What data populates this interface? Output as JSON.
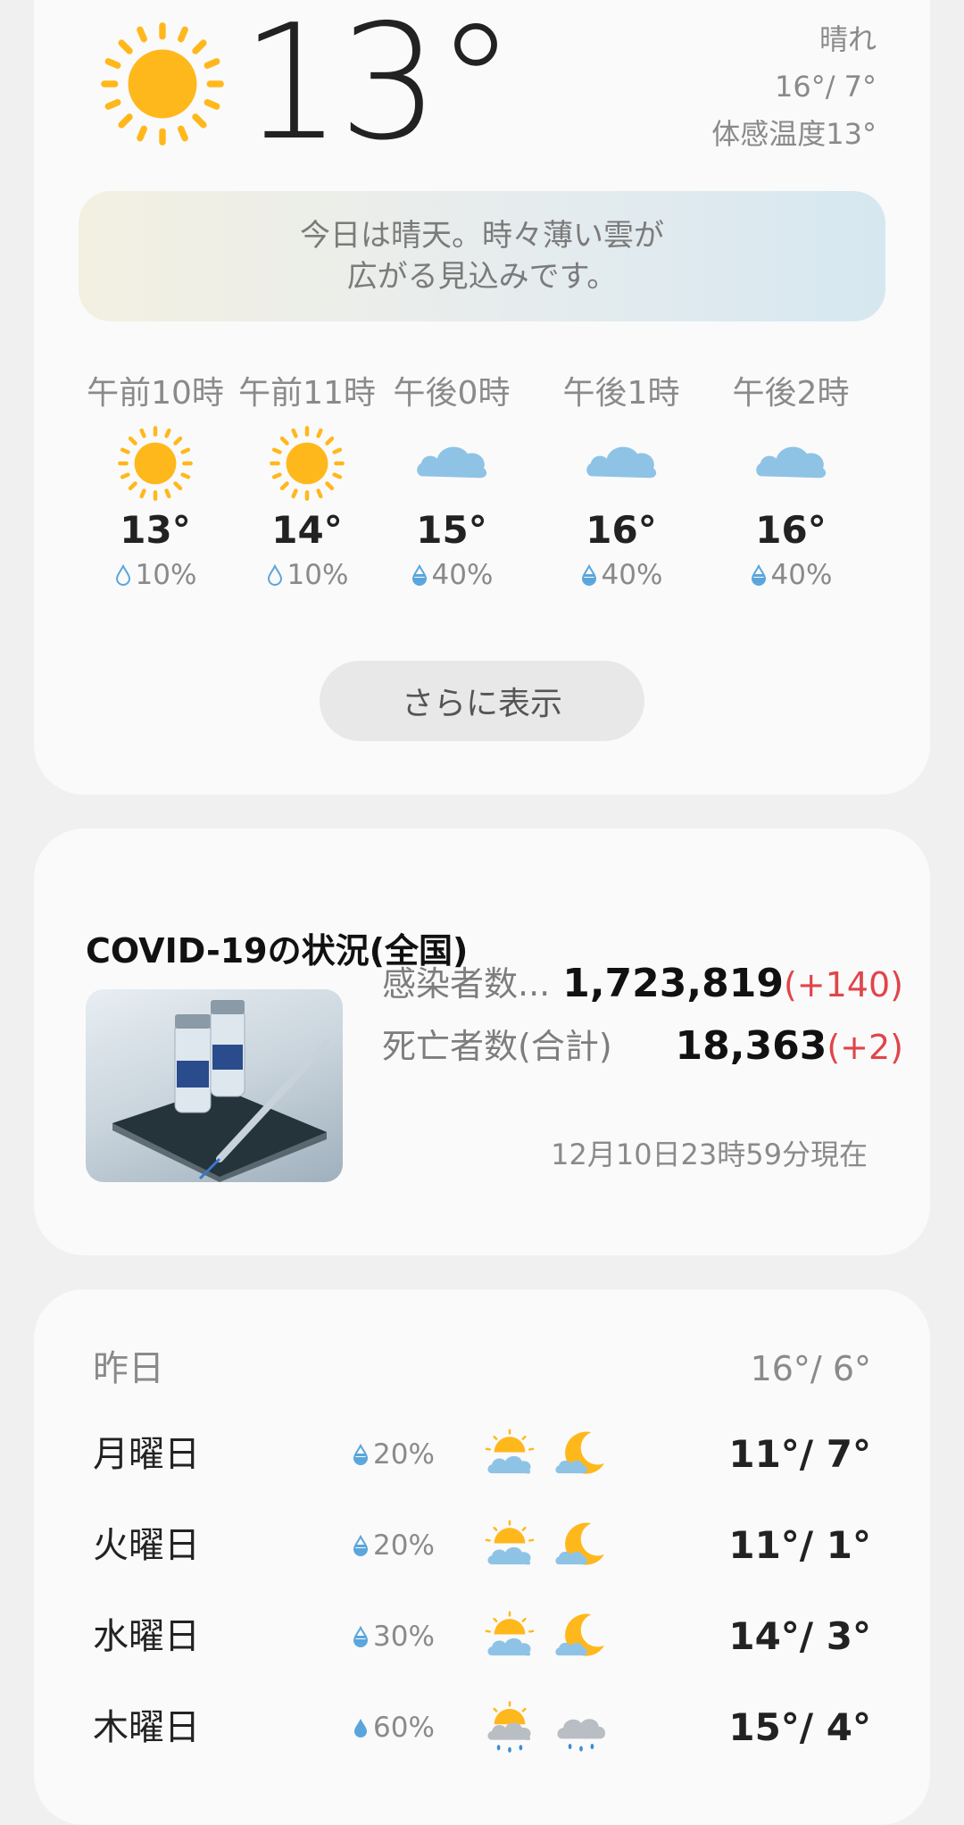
{
  "current": {
    "temperature": "13°",
    "icon": "sun-icon",
    "condition": "晴れ",
    "high_low": "16°/ 7°",
    "feels_like": "体感温度13°",
    "summary_line1": "今日は晴天。時々薄い雲が",
    "summary_line2": "広がる見込みです。",
    "sun_color": "#ffb81c",
    "cloud_color": "#8ec3e6"
  },
  "hourly": [
    {
      "time": "午前10時",
      "icon": "sun-icon",
      "temp": "13°",
      "rain": "10%"
    },
    {
      "time": "午前11時",
      "icon": "sun-icon",
      "temp": "14°",
      "rain": "10%"
    },
    {
      "time": "午後0時",
      "icon": "cloud-icon",
      "temp": "15°",
      "rain": "40%"
    },
    {
      "time": "午後1時",
      "icon": "cloud-icon",
      "temp": "16°",
      "rain": "40%"
    },
    {
      "time": "午後2時",
      "icon": "cloud-icon",
      "temp": "16°",
      "rain": "40%"
    }
  ],
  "more_button": "さらに表示",
  "covid": {
    "title": "COVID-19の状況(全国)",
    "infected_label": "感染者数...",
    "infected_value": "1,723,819",
    "infected_delta": "(+140)",
    "deaths_label": "死亡者数(合計)",
    "deaths_value": "18,363",
    "deaths_delta": "(+2)",
    "timestamp": "12月10日23時59分現在",
    "delta_color": "#e0454a"
  },
  "daily": {
    "yesterday": {
      "day": "昨日",
      "temp": "16°/ 6°"
    },
    "days": [
      {
        "day": "月曜日",
        "rain": "20%",
        "day_icon": "partly-sunny-icon",
        "night_icon": "cloudy-night-icon",
        "temp": "11°/ 7°"
      },
      {
        "day": "火曜日",
        "rain": "20%",
        "day_icon": "partly-sunny-icon",
        "night_icon": "cloudy-night-icon",
        "temp": "11°/ 1°"
      },
      {
        "day": "水曜日",
        "rain": "30%",
        "day_icon": "partly-sunny-icon",
        "night_icon": "cloudy-night-icon",
        "temp": "14°/ 3°"
      },
      {
        "day": "木曜日",
        "rain": "60%",
        "day_icon": "sun-shower-icon",
        "night_icon": "rain-icon",
        "temp": "15°/ 4°"
      }
    ]
  }
}
